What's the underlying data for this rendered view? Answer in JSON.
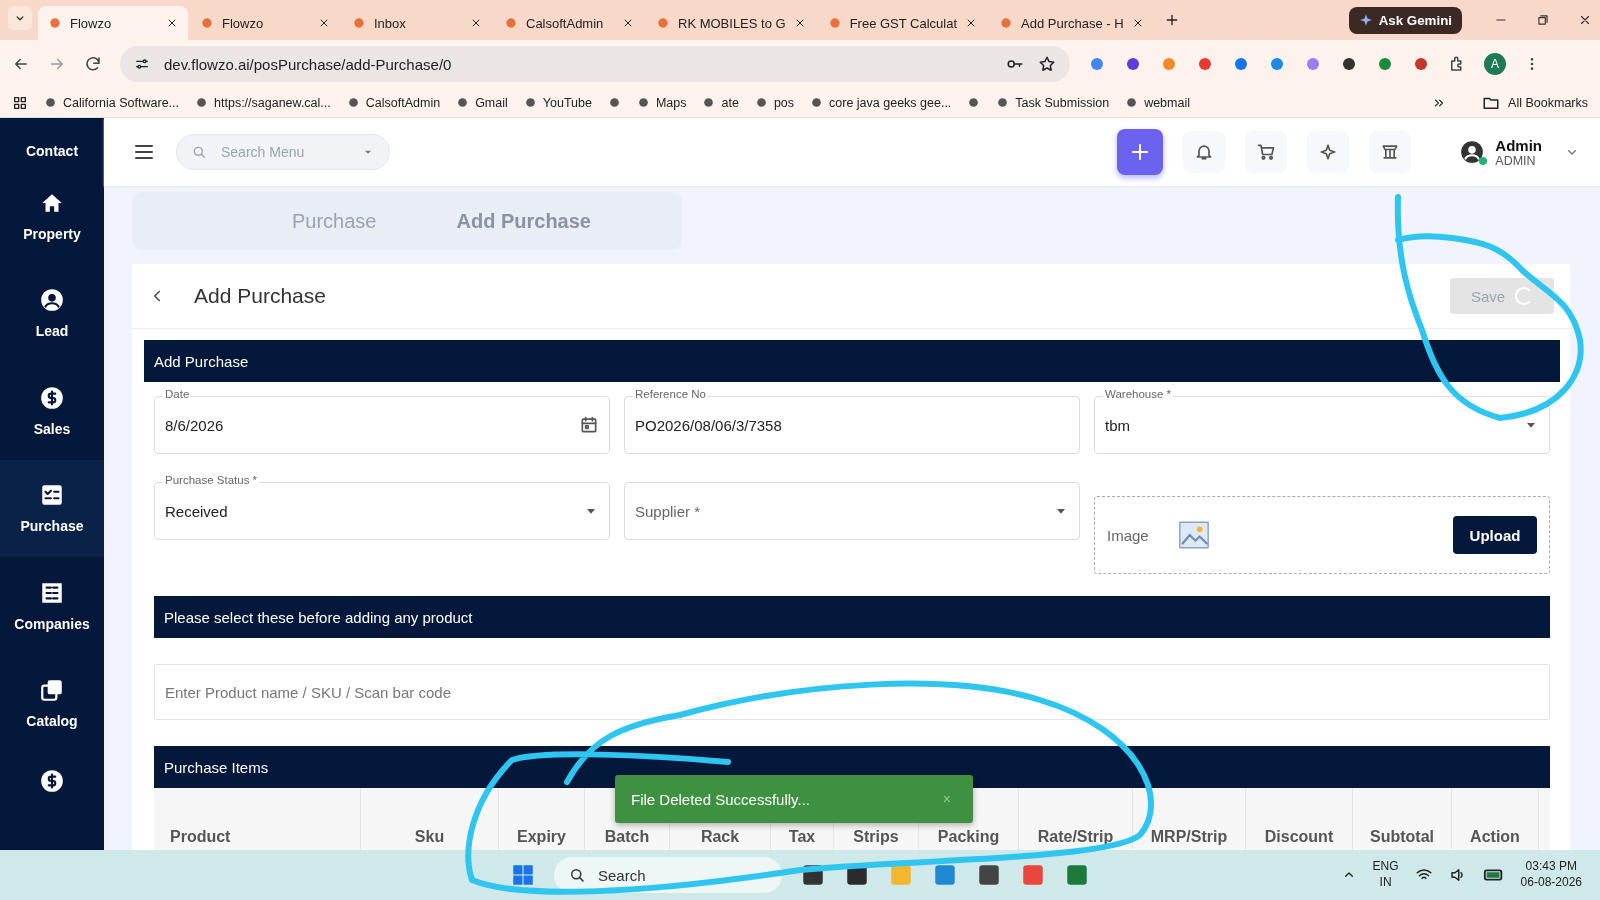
{
  "browser": {
    "tabs": [
      {
        "title": "Flowzo",
        "selected": true
      },
      {
        "title": "Flowzo",
        "selected": false
      },
      {
        "title": "Inbox",
        "selected": false
      },
      {
        "title": "CalsoftAdmin",
        "selected": false
      },
      {
        "title": "RK MOBILES to G",
        "selected": false
      },
      {
        "title": "Free GST Calculat",
        "selected": false
      },
      {
        "title": "Add Purchase - H",
        "selected": false
      }
    ],
    "ask_gemini": "Ask Gemini",
    "url": "dev.flowzo.ai/posPurchase/add-Purchase/0",
    "profile_initial": "A",
    "bookmarks": [
      {
        "kind": "link",
        "label": "California Software..."
      },
      {
        "kind": "link",
        "label": "https://saganew.cal..."
      },
      {
        "kind": "link",
        "label": "CalsoftAdmin"
      },
      {
        "kind": "link",
        "label": "Gmail"
      },
      {
        "kind": "link",
        "label": "YouTube"
      },
      {
        "kind": "icon"
      },
      {
        "kind": "link",
        "label": "Maps"
      },
      {
        "kind": "link",
        "label": "ate"
      },
      {
        "kind": "link",
        "label": "pos"
      },
      {
        "kind": "link",
        "label": "core java geeks gee..."
      },
      {
        "kind": "icon"
      },
      {
        "kind": "link",
        "label": "Task Submission"
      },
      {
        "kind": "link",
        "label": "webmail"
      }
    ],
    "all_bookmarks": "All Bookmarks"
  },
  "sidebar": {
    "items": [
      {
        "label": "Contact",
        "selected": false
      },
      {
        "label": "Property",
        "selected": false
      },
      {
        "label": "Lead",
        "selected": false
      },
      {
        "label": "Sales",
        "selected": false
      },
      {
        "label": "Purchase",
        "selected": true
      },
      {
        "label": "Companies",
        "selected": false
      },
      {
        "label": "Catalog",
        "selected": false
      }
    ]
  },
  "header": {
    "search_placeholder": "Search Menu",
    "user_name": "Admin",
    "user_role": "ADMIN"
  },
  "breadcrumb": [
    "Purchase",
    "Add Purchase"
  ],
  "page": {
    "title": "Add Purchase",
    "save_button": {
      "label": "Save",
      "disabled": true
    },
    "section_title": "Add Purchase",
    "fields": [
      {
        "kind": "date",
        "label": "Date",
        "value": "8/6/2026"
      },
      {
        "kind": "text",
        "label": "Reference No",
        "value": "PO2026/08/06/3/7358"
      },
      {
        "kind": "select",
        "label": "Warehouse *",
        "value": "tbm"
      },
      {
        "kind": "select",
        "label": "Purchase Status *",
        "value": "Received"
      },
      {
        "kind": "select",
        "placeholder": "Supplier *"
      },
      {
        "kind": "image",
        "label": "Image",
        "button": "Upload"
      }
    ],
    "notice": "Please select these before adding any product",
    "product_search": {
      "placeholder": "Enter Product name / SKU / Scan bar code"
    },
    "items_title": "Purchase Items",
    "table": {
      "columns": [
        "Product",
        "Sku",
        "Expiry",
        "Batch",
        "Rack",
        "Tax",
        "Strips",
        "Packing",
        "Rate/Strip",
        "MRP/Strip",
        "Discount",
        "Subtotal",
        "Action"
      ]
    }
  },
  "toast": {
    "message": "File Deleted Successfully...",
    "close": "×"
  },
  "taskbar": {
    "search_placeholder": "Search",
    "language": "ENG",
    "region": "IN",
    "time": "03:43 PM",
    "date": "06-08-2026"
  }
}
